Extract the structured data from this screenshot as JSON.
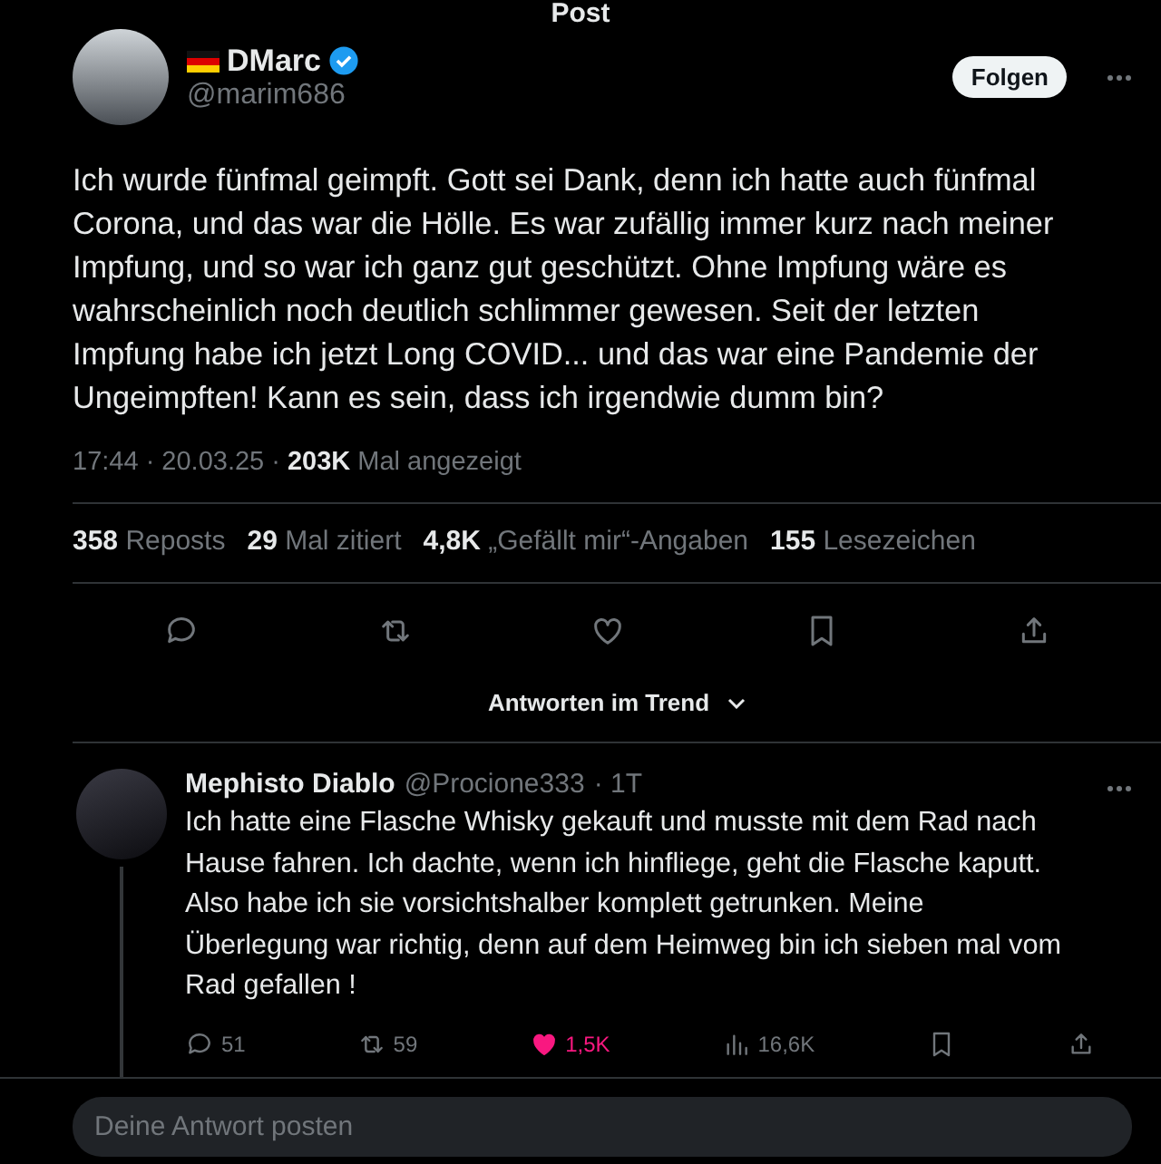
{
  "header": {
    "title": "Post"
  },
  "post": {
    "author": {
      "name": "DMarc",
      "handle": "@marim686",
      "verified": true
    },
    "follow_button": "Folgen",
    "text": "Ich wurde fünfmal geimpft. Gott sei Dank, denn ich hatte auch fünfmal Corona, und das war die Hölle. Es war zufällig immer kurz nach meiner Impfung, und so war ich ganz gut geschützt. Ohne Impfung wäre es wahrscheinlich noch deutlich schlimmer gewesen. Seit der letzten Impfung habe ich jetzt Long COVID... und das war eine Pandemie der Ungeimpften! Kann es sein, dass ich irgendwie dumm bin?",
    "meta": {
      "time": "17:44 · 20.03.25 ·",
      "views": "203K",
      "views_label": "Mal angezeigt"
    },
    "stats": [
      "**358** Reposts",
      "**29** Mal zitiert",
      "**4,8K** „Gefällt mir“-Angaben",
      "**155** Lesezeichen"
    ],
    "actions": [
      {
        "kind": "reply"
      },
      {
        "kind": "repost"
      },
      {
        "kind": "like"
      },
      {
        "kind": "bookmark"
      },
      {
        "kind": "share"
      }
    ]
  },
  "sort": {
    "label": "Antworten im Trend"
  },
  "reply": {
    "name": "Mephisto Diablo",
    "handle": "@Procione333",
    "age": "· 1T",
    "text": "Ich hatte eine Flasche Whisky gekauft und musste mit dem Rad nach Hause fahren. Ich dachte, wenn ich hinfliege, geht die Flasche kaputt. Also habe ich sie vorsichtshalber komplett getrunken. Meine Überlegung war richtig, denn auf dem Heimweg bin ich sieben mal vom Rad gefallen !",
    "actions": [
      {
        "kind": "reply",
        "count": "51",
        "active": false
      },
      {
        "kind": "repost",
        "count": "59",
        "active": false
      },
      {
        "kind": "like",
        "count": "1,5K",
        "active": true
      },
      {
        "kind": "views",
        "count": "16,6K",
        "active": false
      },
      {
        "kind": "bookmark",
        "active": false
      },
      {
        "kind": "share",
        "active": false
      }
    ]
  },
  "composer": {
    "placeholder": "Deine Antwort posten"
  }
}
